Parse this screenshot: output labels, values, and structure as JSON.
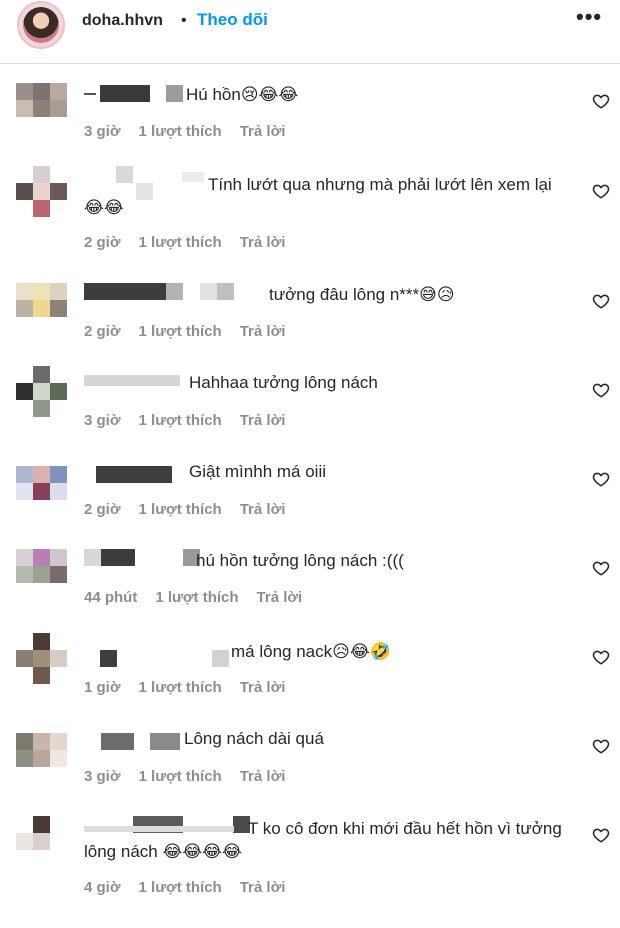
{
  "header": {
    "username": "doha.hhvn",
    "separator": "•",
    "follow_label": "Theo dõi",
    "more_label": "•••"
  },
  "colors": {
    "accent": "#0095f6",
    "meta": "#8e8e8e",
    "text": "#262626",
    "divider": "#dbdbdb"
  },
  "icons": {
    "like": "heart-outline-icon",
    "more": "more-options-icon"
  },
  "comments": [
    {
      "text": "Hú hồn😢😂😂",
      "time": "3 giờ",
      "likes": "1 lượt thích",
      "reply": "Trả lời"
    },
    {
      "text": "Tính lướt qua nhưng mà phải lướt lên xem lại😂😂",
      "time": "2 giờ",
      "likes": "1 lượt thích",
      "reply": "Trả lời"
    },
    {
      "text": "tưởng đâu lông n***😅😥",
      "time": "2 giờ",
      "likes": "1 lượt thích",
      "reply": "Trả lời"
    },
    {
      "text": "Hahhaa tưởng lông nách",
      "time": "3 giờ",
      "likes": "1 lượt thích",
      "reply": "Trả lời"
    },
    {
      "text": "Giật mìnhh má oiii",
      "time": "2 giờ",
      "likes": "1 lượt thích",
      "reply": "Trả lời"
    },
    {
      "text": "hú hồn tưởng lông nách :(((",
      "time": "44 phút",
      "likes": "1 lượt thích",
      "reply": "Trả lời"
    },
    {
      "text": "má lông nack😥😂🤣",
      "time": "1 giờ",
      "likes": "1 lượt thích",
      "reply": "Trả lời"
    },
    {
      "text": "Lông nách dài quá",
      "time": "3 giờ",
      "likes": "1 lượt thích",
      "reply": "Trả lời"
    },
    {
      "text": "T ko cô đơn khi mới đầu hết hồn vì tưởng lông nách 😂😂😂😂",
      "time": "4 giờ",
      "likes": "1 lượt thích",
      "reply": "Trả lời"
    }
  ]
}
